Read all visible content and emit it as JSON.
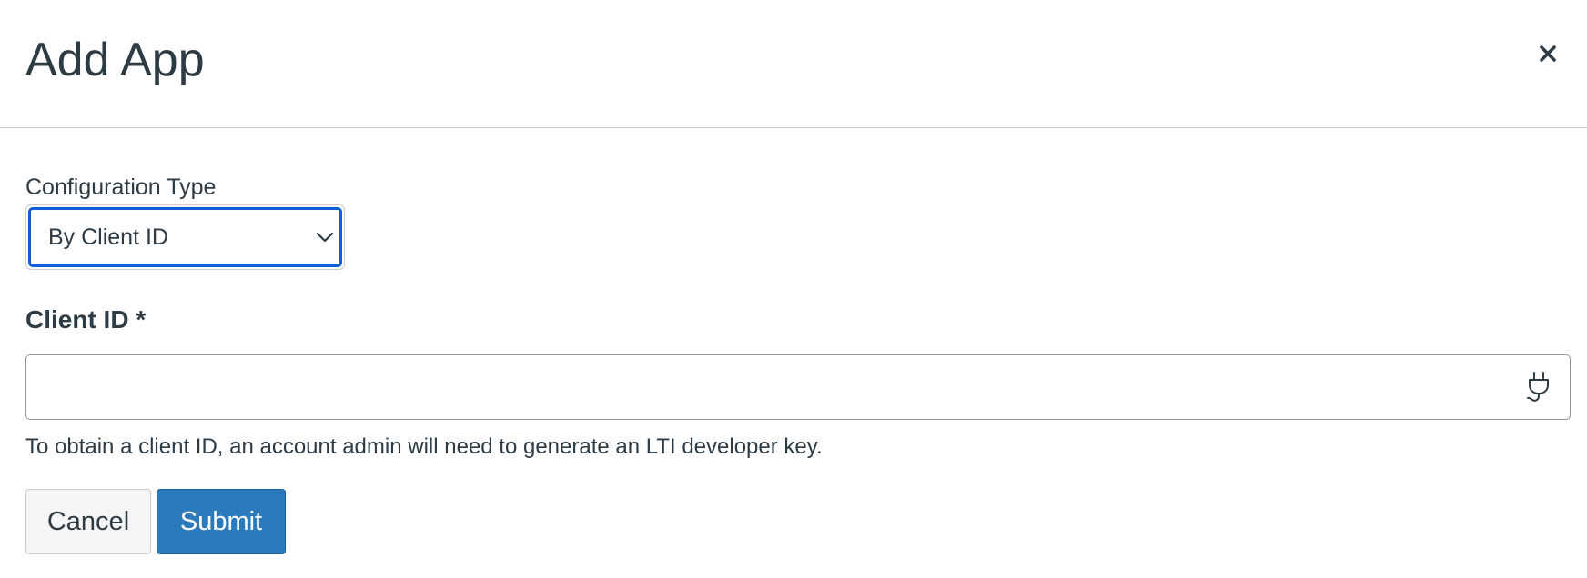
{
  "dialog": {
    "title": "Add App",
    "close_icon": "close-icon"
  },
  "configuration": {
    "label": "Configuration Type",
    "selected_value": "By Client ID",
    "dropdown_icon": "chevron-down-icon"
  },
  "client_id": {
    "label": "Client ID *",
    "value": "",
    "icon": "plug-icon",
    "help_text": "To obtain a client ID, an account admin will need to generate an LTI developer key."
  },
  "buttons": {
    "cancel_label": "Cancel",
    "submit_label": "Submit"
  },
  "colors": {
    "text": "#2d3b45",
    "focus_ring": "#0b5fd4",
    "primary_button": "#2b7abc",
    "secondary_button": "#f5f5f5",
    "divider": "#c7cdd1"
  }
}
